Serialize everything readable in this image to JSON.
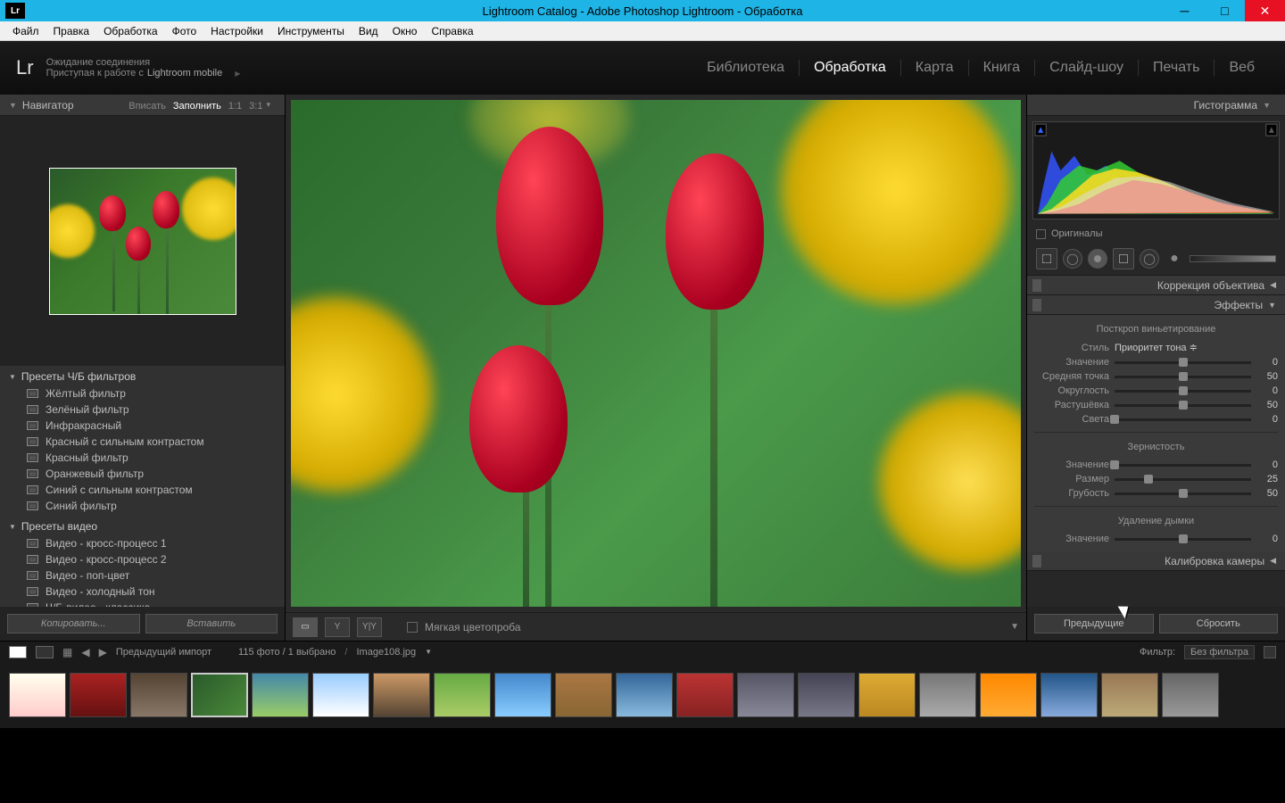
{
  "titlebar": {
    "title": "Lightroom Catalog - Adobe Photoshop Lightroom - Обработка",
    "badge": "Lr"
  },
  "menu": [
    "Файл",
    "Правка",
    "Обработка",
    "Фото",
    "Настройки",
    "Инструменты",
    "Вид",
    "Окно",
    "Справка"
  ],
  "topbar": {
    "logo": "Lr",
    "status1": "Ожидание соединения",
    "status2_pre": "Приступая к работе с ",
    "status2_mobile": "Lightroom mobile",
    "modules": [
      "Библиотека",
      "Обработка",
      "Карта",
      "Книга",
      "Слайд-шоу",
      "Печать",
      "Веб"
    ],
    "active_module": "Обработка"
  },
  "navigator": {
    "title": "Навигатор",
    "opts": [
      "Вписать",
      "Заполнить",
      "1:1",
      "3:1"
    ],
    "active_opt": "Заполнить"
  },
  "presets": {
    "group1": "Пресеты Ч/Б фильтров",
    "items1": [
      "Жёлтый фильтр",
      "Зелёный фильтр",
      "Инфракрасный",
      "Красный с сильным контрастом",
      "Красный фильтр",
      "Оранжевый фильтр",
      "Синий с сильным контрастом",
      "Синий фильтр"
    ],
    "group2": "Пресеты видео",
    "items2": [
      "Видео - кросс-процесс 1",
      "Видео - кросс-процесс 2",
      "Видео - поп-цвет",
      "Видео - холодный тон",
      "Ч/Б-вилео - классика"
    ]
  },
  "left_buttons": {
    "copy": "Копировать...",
    "paste": "Вставить"
  },
  "center_toolbar": {
    "softproof": "Мягкая цветопроба"
  },
  "right": {
    "histogram": "Гистограмма",
    "originals": "Оригиналы",
    "panel_lens": "Коррекция объектива",
    "panel_effects": "Эффекты",
    "vignette_title": "Посткроп виньетирование",
    "style_label": "Стиль",
    "style_value": "Приоритет тона",
    "sliders_vig": [
      {
        "label": "Значение",
        "val": "0",
        "pos": 50
      },
      {
        "label": "Средняя точка",
        "val": "50",
        "pos": 50
      },
      {
        "label": "Округлость",
        "val": "0",
        "pos": 50
      },
      {
        "label": "Растушёвка",
        "val": "50",
        "pos": 50
      },
      {
        "label": "Света",
        "val": "0",
        "pos": 0
      }
    ],
    "grain_title": "Зернистость",
    "sliders_grain": [
      {
        "label": "Значение",
        "val": "0",
        "pos": 0
      },
      {
        "label": "Размер",
        "val": "25",
        "pos": 25
      },
      {
        "label": "Грубость",
        "val": "50",
        "pos": 50
      }
    ],
    "dehaze_title": "Удаление дымки",
    "sliders_dehaze": [
      {
        "label": "Значение",
        "val": "0",
        "pos": 50
      }
    ],
    "panel_calib": "Калибровка камеры",
    "prev_btn": "Предыдущие",
    "reset_btn": "Сбросить"
  },
  "filmstrip_head": {
    "prev_import": "Предыдущий импорт",
    "count": "115 фото / 1 выбрано",
    "filename": "Image108.jpg",
    "filter_label": "Фильтр:",
    "filter_value": "Без фильтра"
  },
  "thumb_colors": [
    "linear-gradient(#ffe,#fcc)",
    "linear-gradient(#a22,#611)",
    "linear-gradient(#543,#876)",
    "linear-gradient(135deg,#2a5a2a,#4a8a3a)",
    "linear-gradient(#48a,#9c6)",
    "linear-gradient(#9cf,#fff)",
    "linear-gradient(#c96,#543)",
    "linear-gradient(#6a4,#ac6)",
    "linear-gradient(#48c,#8cf)",
    "linear-gradient(#a74,#863)",
    "linear-gradient(#369,#8bd)",
    "linear-gradient(#b33,#822)",
    "linear-gradient(#556,#889)",
    "linear-gradient(#445,#778)",
    "linear-gradient(#da3,#b82)",
    "linear-gradient(#777,#aaa)",
    "linear-gradient(#f80,#fa3)",
    "linear-gradient(#258,#8ad)",
    "linear-gradient(#975,#ba7)",
    "linear-gradient(#666,#999)"
  ]
}
